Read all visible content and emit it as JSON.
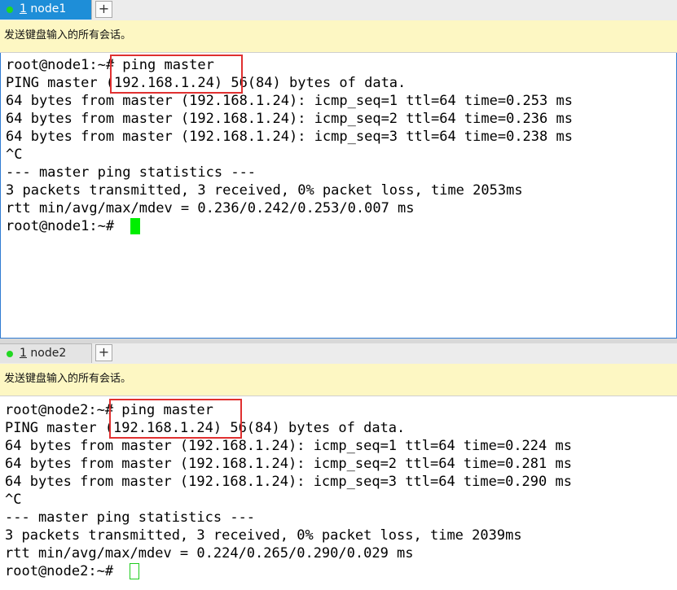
{
  "panes": [
    {
      "tab": {
        "number": "1",
        "name": "node1",
        "active": true
      },
      "banner": "发送键盘输入的所有会话。",
      "lines": [
        "root@node1:~# ping master",
        "PING master (192.168.1.24) 56(84) bytes of data.",
        "64 bytes from master (192.168.1.24): icmp_seq=1 ttl=64 time=0.253 ms",
        "64 bytes from master (192.168.1.24): icmp_seq=2 ttl=64 time=0.236 ms",
        "64 bytes from master (192.168.1.24): icmp_seq=3 ttl=64 time=0.238 ms",
        "^C",
        "--- master ping statistics ---",
        "3 packets transmitted, 3 received, 0% packet loss, time 2053ms",
        "rtt min/avg/max/mdev = 0.236/0.242/0.253/0.007 ms",
        "root@node1:~# "
      ]
    },
    {
      "tab": {
        "number": "1",
        "name": "node2",
        "active": false
      },
      "banner": "发送键盘输入的所有会话。",
      "lines": [
        "root@node2:~# ping master",
        "PING master (192.168.1.24) 56(84) bytes of data.",
        "64 bytes from master (192.168.1.24): icmp_seq=1 ttl=64 time=0.224 ms",
        "64 bytes from master (192.168.1.24): icmp_seq=2 ttl=64 time=0.281 ms",
        "64 bytes from master (192.168.1.24): icmp_seq=3 ttl=64 time=0.290 ms",
        "^C",
        "--- master ping statistics ---",
        "3 packets transmitted, 3 received, 0% packet loss, time 2039ms",
        "rtt min/avg/max/mdev = 0.224/0.265/0.290/0.029 ms",
        "root@node2:~# "
      ]
    }
  ],
  "add_tab_label": "+",
  "colors": {
    "active_tab": "#1e8ed8",
    "status_dot": "#22d822",
    "banner_bg": "#fdf7c3",
    "highlight_box": "#e03030",
    "cursor": "#00ee00"
  }
}
